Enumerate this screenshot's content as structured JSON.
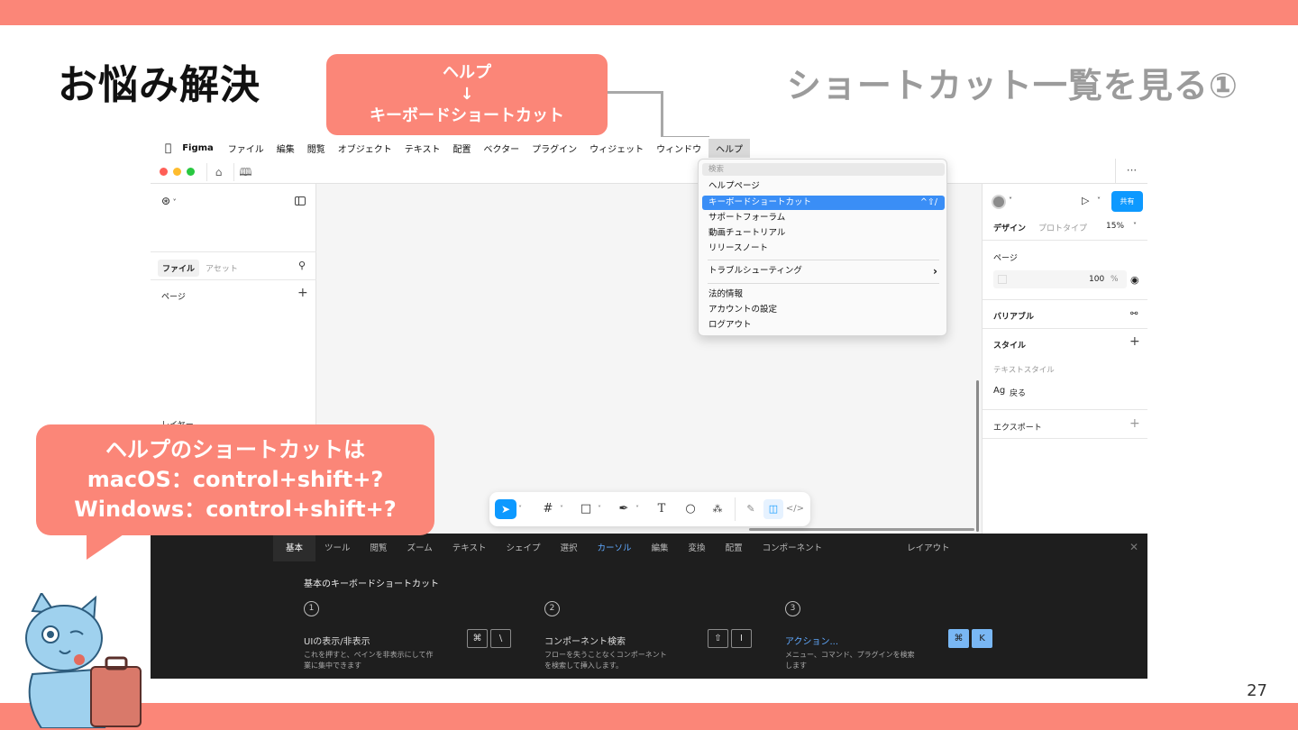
{
  "slide": {
    "title": "お悩み解決",
    "subtitle": "ショートカット一覧を見る①",
    "page_number": "27",
    "callout_top": [
      "ヘルプ",
      "↓",
      "キーボードショートカット"
    ],
    "callout_left": [
      "ヘルプのショートカットは",
      "macOS：control+shift+?",
      "Windows：control+shift+?"
    ],
    "colors": {
      "accent": "#fb8678",
      "subtitle": "#9b9b9b",
      "highlight": "#3a8ef6"
    }
  },
  "menubar": {
    "apple": "",
    "app": "Figma",
    "items": [
      "ファイル",
      "編集",
      "閲覧",
      "オブジェクト",
      "テキスト",
      "配置",
      "ベクター",
      "プラグイン",
      "ウィジェット",
      "ウィンドウ"
    ],
    "help": "ヘルプ"
  },
  "help_menu": {
    "search_placeholder": "検索",
    "items": [
      "ヘルプページ",
      "キーボードショートカット",
      "サポートフォーラム",
      "動画チュートリアル",
      "リリースノート",
      "トラブルシューティング",
      "法的情報",
      "アカウントの設定",
      "ログアウト"
    ],
    "highlighted_shortcut": "^⇧/",
    "submenu_arrow": "›"
  },
  "left_panel": {
    "tab_file": "ファイル",
    "tab_assets": "アセット",
    "pages_label": "ページ",
    "layers_label": "レイヤー"
  },
  "right_panel": {
    "share_button": "共有",
    "tab_design": "デザイン",
    "tab_prototype": "プロトタイプ",
    "zoom": "15%",
    "page_label": "ページ",
    "fill_value": "100",
    "fill_unit": "%",
    "variables_label": "バリアブル",
    "styles_label": "スタイル",
    "text_styles_label": "テキストスタイル",
    "text_style_sample": "Ag",
    "text_style_name": "戻る",
    "export_label": "エクスポート"
  },
  "shortcut_panel": {
    "tabs": [
      "基本",
      "ツール",
      "閲覧",
      "ズーム",
      "テキスト",
      "シェイプ",
      "選択",
      "カーソル",
      "編集",
      "変換",
      "配置",
      "コンポーネント",
      "レイアウト"
    ],
    "heading": "基本のキーボードショートカット",
    "cards": [
      {
        "num": "1",
        "title": "UIの表示/非表示",
        "desc1": "これを押すと、ペインを非表示にして作",
        "desc2": "業に集中できます",
        "keys": [
          "⌘",
          "\\"
        ]
      },
      {
        "num": "2",
        "title": "コンポーネント検索",
        "desc1": "フローを失うことなくコンポーネント",
        "desc2": "を検索して挿入します。",
        "keys": [
          "⇧",
          "I"
        ]
      },
      {
        "num": "3",
        "title": "アクション...",
        "desc1": "メニュー、コマンド、プラグインを検索",
        "desc2": "します",
        "keys": [
          "⌘",
          "K"
        ]
      }
    ]
  }
}
